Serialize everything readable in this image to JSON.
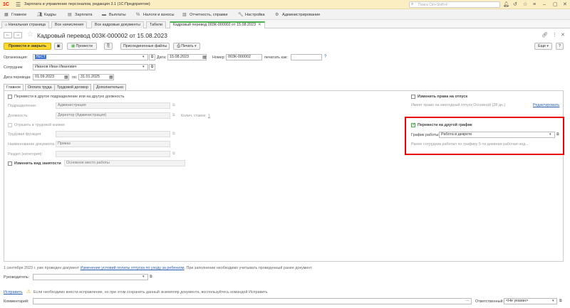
{
  "app": {
    "title": "Зарплата и управление персоналом, редакция 3.1  (1С:Предприятие)",
    "logo": "1С"
  },
  "search": {
    "placeholder": "Поиск Ctrl+Shift+F"
  },
  "menu": [
    {
      "label": "Главное",
      "icon": "grid-icon"
    },
    {
      "label": "Кадры",
      "icon": "people-icon"
    },
    {
      "label": "Зарплата",
      "icon": "calculator-icon"
    },
    {
      "label": "Выплаты",
      "icon": "wallet-icon"
    },
    {
      "label": "Налоги и взносы",
      "icon": "percent-icon"
    },
    {
      "label": "Отчетность, справки",
      "icon": "report-icon"
    },
    {
      "label": "Настройка",
      "icon": "wrench-icon"
    },
    {
      "label": "Администрирование",
      "icon": "gear-icon"
    }
  ],
  "open_tabs": [
    {
      "label": "Начальная страница"
    },
    {
      "label": "Все начисления"
    },
    {
      "label": "Все кадровые документы"
    },
    {
      "label": "Табели"
    },
    {
      "label": "Кадровый перевод 003К-000002 от 15.08.2023"
    }
  ],
  "doc": {
    "title": "Кадровый перевод 003К-000002 от 15.08.2023",
    "toolbar": {
      "post_close": "Провести и закрыть",
      "post": "Провести",
      "attached": "Присоединенные файлы",
      "print": "Печать",
      "more": "Еще",
      "help": "?"
    },
    "org_label": "Организация:",
    "org_value": "ЛЕСТ",
    "date_label": "Дата:",
    "date_value": "15.08.2023",
    "num_label": "Номер:",
    "num_value": "003К-000002",
    "print_as_label": "печатать как:",
    "print_as_value": "",
    "emp_label": "Сотрудник:",
    "emp_value": "Иванов Иван Иванович",
    "from_label": "Дата перевода:",
    "from_value": "01.09.2023",
    "to_label": "по:",
    "to_value": "31.01.2025",
    "form_tabs": [
      "Главное",
      "Оплата труда",
      "Трудовой договор",
      "Дополнительно"
    ],
    "transfer_chk": "Перевести в другое подразделение или на другую должность",
    "dept_label": "Подразделение:",
    "dept_value": "Администрация",
    "pos_label": "Должность:",
    "pos_value": "Директор (Администрация)",
    "rate_label": "Колич. ставок:",
    "rate_value": "1",
    "workbook_chk": "Отразить в трудовой книжке",
    "func_label": "Трудовая функция:",
    "func_value": "",
    "docname_label": "Наименование документа:",
    "docname_value": "Приказ",
    "section_label": "Раздел (категория):",
    "section_value": "",
    "employment_chk": "Изменить вид занятости",
    "employment_value": "Основное место работы",
    "vacation_chk": "Изменить права на отпуск",
    "vacation_info": "Имеет право на ежегодный отпуск Основной (28 дн.)",
    "vacation_edit": "Редактировать",
    "schedule_chk": "Перевести на другой график",
    "schedule_label": "График работы:",
    "schedule_value": "Работа в декрете",
    "schedule_info": "Ранее сотрудник работал по графику 5-ти дневная рабочая нед...",
    "notice_pre": "1 сентября 2023 г. уже проведен документ ",
    "notice_link": "Изменение условий оплаты отпуска по уходу за ребенком",
    "notice_post": ". При заполнении необходимо учитывать проведенный ранее документ.",
    "manager_label": "Руководитель:",
    "manager_value": "",
    "fix_link": "Исправить",
    "fix_text": "Если необходимо внести исправление, но при этом сохранить данный экземпляр документа, воспользуйтесь командой Исправить",
    "comment_label": "Комментарий:",
    "comment_value": "",
    "resp_label": "Ответственный:",
    "resp_value": "<Не указан>"
  },
  "colors": {
    "accent": "#ffd930",
    "titlebar": "#fbeec3",
    "highlight": "#e00000",
    "link": "#2a5db0"
  }
}
